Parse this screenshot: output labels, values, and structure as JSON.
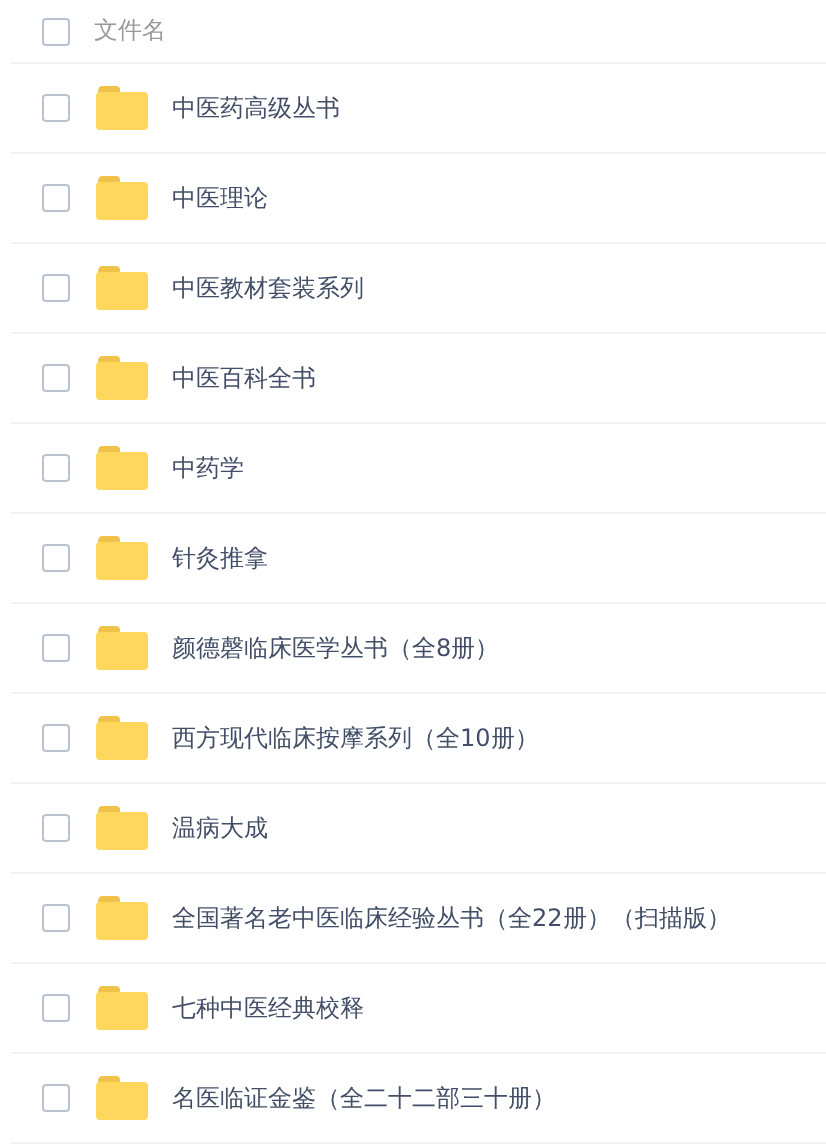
{
  "header": {
    "checked": false,
    "label": "文件名"
  },
  "files": [
    {
      "name": "中医药高级丛书",
      "kind": "folder",
      "checked": false
    },
    {
      "name": "中医理论",
      "kind": "folder",
      "checked": false
    },
    {
      "name": "中医教材套装系列",
      "kind": "folder",
      "checked": false
    },
    {
      "name": "中医百科全书",
      "kind": "folder",
      "checked": false
    },
    {
      "name": "中药学",
      "kind": "folder",
      "checked": false
    },
    {
      "name": "针灸推拿",
      "kind": "folder",
      "checked": false
    },
    {
      "name": "颜德磬临床医学丛书（全8册）",
      "kind": "folder",
      "checked": false
    },
    {
      "name": "西方现代临床按摩系列（全10册）",
      "kind": "folder",
      "checked": false
    },
    {
      "name": "温病大成",
      "kind": "folder",
      "checked": false
    },
    {
      "name": "全国著名老中医临床经验丛书（全22册）（扫描版）",
      "kind": "folder",
      "checked": false
    },
    {
      "name": "七种中医经典校释",
      "kind": "folder",
      "checked": false
    },
    {
      "name": "名医临证金鉴（全二十二部三十册）",
      "kind": "folder",
      "checked": false
    }
  ]
}
